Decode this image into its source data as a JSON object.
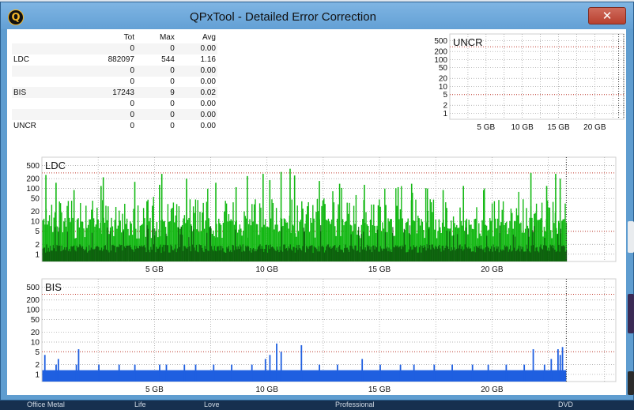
{
  "window": {
    "title": "QPxTool - Detailed Error Correction",
    "app_icon": "Q",
    "close_glyph": "✕"
  },
  "stats": {
    "columns": [
      "",
      "Tot",
      "Max",
      "Avg"
    ],
    "rows": [
      {
        "label": "",
        "tot": "0",
        "max": "0",
        "avg": "0.00"
      },
      {
        "label": "LDC",
        "tot": "882097",
        "max": "544",
        "avg": "1.16"
      },
      {
        "label": "",
        "tot": "0",
        "max": "0",
        "avg": "0.00"
      },
      {
        "label": "",
        "tot": "0",
        "max": "0",
        "avg": "0.00"
      },
      {
        "label": "BIS",
        "tot": "17243",
        "max": "9",
        "avg": "0.02"
      },
      {
        "label": "",
        "tot": "0",
        "max": "0",
        "avg": "0.00"
      },
      {
        "label": "",
        "tot": "0",
        "max": "0",
        "avg": "0.00"
      },
      {
        "label": "UNCR",
        "tot": "0",
        "max": "0",
        "avg": "0.00"
      }
    ]
  },
  "chart_data": [
    {
      "type": "bar",
      "title": "UNCR",
      "y_scale": "log",
      "y_ticks": [
        500,
        200,
        100,
        50,
        20,
        10,
        5,
        2,
        1
      ],
      "x_ticks": [
        5,
        10,
        15,
        20
      ],
      "x_tick_labels": [
        "5 GB",
        "10 GB",
        "15 GB",
        "20 GB"
      ],
      "xlim": [
        0,
        24
      ],
      "threshold_lines": [
        300,
        5
      ],
      "grid": true,
      "color": "#1f5fe0",
      "values": []
    },
    {
      "type": "bar",
      "title": "LDC",
      "y_scale": "log",
      "y_ticks": [
        500,
        200,
        100,
        50,
        20,
        10,
        5,
        2,
        1
      ],
      "x_ticks": [
        5,
        10,
        15,
        20
      ],
      "x_tick_labels": [
        "5 GB",
        "10 GB",
        "15 GB",
        "20 GB"
      ],
      "xlim": [
        0,
        25.5
      ],
      "data_end_gb": 23.3,
      "threshold_lines": [
        300,
        5
      ],
      "grid": true,
      "color": "#14b814",
      "avg_color": "#0a4f0a",
      "typical_range": [
        2,
        20
      ],
      "spikes": [
        {
          "x": 0.15,
          "y": 260
        },
        {
          "x": 0.6,
          "y": 150
        },
        {
          "x": 1.4,
          "y": 90
        },
        {
          "x": 2.6,
          "y": 120
        },
        {
          "x": 2.7,
          "y": 220
        },
        {
          "x": 4.1,
          "y": 160
        },
        {
          "x": 5.2,
          "y": 130
        },
        {
          "x": 5.3,
          "y": 280
        },
        {
          "x": 6.4,
          "y": 200
        },
        {
          "x": 7.7,
          "y": 150
        },
        {
          "x": 8.6,
          "y": 110
        },
        {
          "x": 9.1,
          "y": 240
        },
        {
          "x": 9.8,
          "y": 280
        },
        {
          "x": 10.1,
          "y": 180
        },
        {
          "x": 10.6,
          "y": 320
        },
        {
          "x": 11.0,
          "y": 400
        },
        {
          "x": 11.2,
          "y": 250
        },
        {
          "x": 12.3,
          "y": 170
        },
        {
          "x": 13.2,
          "y": 140
        },
        {
          "x": 14.3,
          "y": 130
        },
        {
          "x": 15.8,
          "y": 110
        },
        {
          "x": 16.4,
          "y": 140
        },
        {
          "x": 17.1,
          "y": 100
        },
        {
          "x": 17.8,
          "y": 90
        },
        {
          "x": 18.7,
          "y": 120
        },
        {
          "x": 19.6,
          "y": 90
        },
        {
          "x": 21.7,
          "y": 300
        },
        {
          "x": 22.4,
          "y": 120
        },
        {
          "x": 22.8,
          "y": 280
        },
        {
          "x": 23.0,
          "y": 200
        }
      ]
    },
    {
      "type": "bar",
      "title": "BIS",
      "y_scale": "log",
      "y_ticks": [
        500,
        200,
        100,
        50,
        20,
        10,
        5,
        2,
        1
      ],
      "x_ticks": [
        5,
        10,
        15,
        20
      ],
      "x_tick_labels": [
        "5 GB",
        "10 GB",
        "15 GB",
        "20 GB"
      ],
      "xlim": [
        0,
        25.5
      ],
      "data_end_gb": 23.3,
      "threshold_lines": [
        300,
        5
      ],
      "grid": true,
      "color": "#1f5fe0",
      "baseline": 1,
      "spikes": [
        {
          "x": 0.1,
          "y": 4
        },
        {
          "x": 0.6,
          "y": 2
        },
        {
          "x": 0.7,
          "y": 3
        },
        {
          "x": 1.5,
          "y": 2
        },
        {
          "x": 1.6,
          "y": 6
        },
        {
          "x": 2.5,
          "y": 2
        },
        {
          "x": 3.4,
          "y": 2
        },
        {
          "x": 4.1,
          "y": 2
        },
        {
          "x": 5.2,
          "y": 2
        },
        {
          "x": 5.5,
          "y": 2
        },
        {
          "x": 6.3,
          "y": 2
        },
        {
          "x": 6.8,
          "y": 2
        },
        {
          "x": 7.6,
          "y": 2
        },
        {
          "x": 8.4,
          "y": 2
        },
        {
          "x": 9.3,
          "y": 2
        },
        {
          "x": 9.9,
          "y": 3
        },
        {
          "x": 10.1,
          "y": 4
        },
        {
          "x": 10.4,
          "y": 9
        },
        {
          "x": 10.6,
          "y": 5
        },
        {
          "x": 11.5,
          "y": 8
        },
        {
          "x": 12.3,
          "y": 2
        },
        {
          "x": 13.1,
          "y": 2
        },
        {
          "x": 14.2,
          "y": 3
        },
        {
          "x": 15.0,
          "y": 2
        },
        {
          "x": 15.9,
          "y": 2
        },
        {
          "x": 16.5,
          "y": 2
        },
        {
          "x": 17.4,
          "y": 2
        },
        {
          "x": 18.2,
          "y": 2
        },
        {
          "x": 19.1,
          "y": 2
        },
        {
          "x": 19.8,
          "y": 2
        },
        {
          "x": 20.6,
          "y": 2
        },
        {
          "x": 21.4,
          "y": 2
        },
        {
          "x": 21.8,
          "y": 6
        },
        {
          "x": 22.3,
          "y": 2
        },
        {
          "x": 22.6,
          "y": 3
        },
        {
          "x": 22.9,
          "y": 6
        },
        {
          "x": 23.0,
          "y": 4
        },
        {
          "x": 23.1,
          "y": 7
        }
      ]
    }
  ],
  "taskbar": {
    "items": [
      "Office Metal",
      "Life",
      "Love",
      "Professional",
      "DVD"
    ]
  },
  "colors": {
    "title_bar": "#6ea9da",
    "threshold_line": "#c0392b",
    "grid": "#9a9a9a",
    "plot_bg": "#ffffff"
  }
}
